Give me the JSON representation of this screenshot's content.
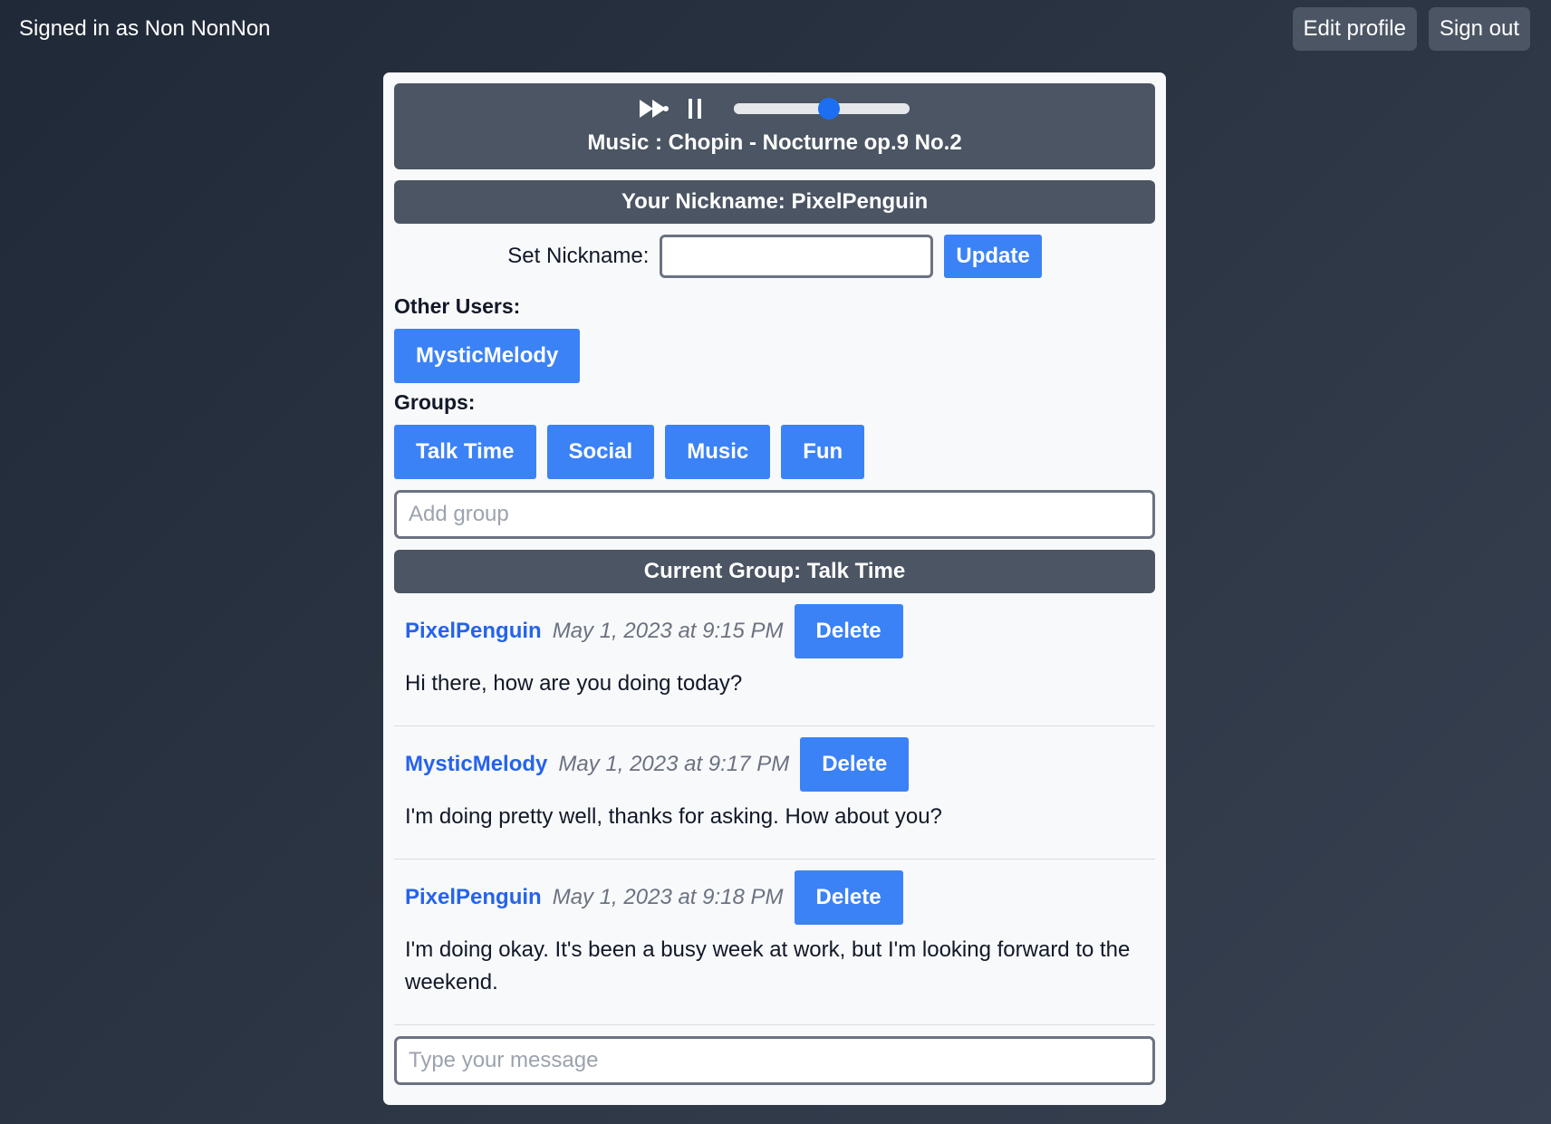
{
  "topbar": {
    "signed_in_text": "Signed in as Non NonNon",
    "edit_profile_label": "Edit profile",
    "sign_out_label": "Sign out"
  },
  "player": {
    "controls": [
      "fast-forward-icon",
      "pause-icon"
    ],
    "volume_level": 0.54,
    "track_text": "Music : Chopin - Nocturne op.9 No.2"
  },
  "nickname": {
    "banner": "Your Nickname: PixelPenguin",
    "set_label": "Set Nickname:",
    "input_value": "",
    "update_label": "Update"
  },
  "other_users": {
    "heading": "Other Users:",
    "users": [
      "MysticMelody"
    ]
  },
  "groups": {
    "heading": "Groups:",
    "items": [
      "Talk Time",
      "Social",
      "Music",
      "Fun"
    ],
    "add_placeholder": "Add group"
  },
  "current_group": {
    "banner": "Current Group: Talk Time"
  },
  "messages": [
    {
      "author": "PixelPenguin",
      "time": "May 1, 2023 at 9:15 PM",
      "delete_label": "Delete",
      "text": "Hi there, how are you doing today?"
    },
    {
      "author": "MysticMelody",
      "time": "May 1, 2023 at 9:17 PM",
      "delete_label": "Delete",
      "text": "I'm doing pretty well, thanks for asking. How about you?"
    },
    {
      "author": "PixelPenguin",
      "time": "May 1, 2023 at 9:18 PM",
      "delete_label": "Delete",
      "text": "I'm doing okay. It's been a busy week at work, but I'm looking forward to the weekend."
    }
  ],
  "composer": {
    "placeholder": "Type your message"
  },
  "colors": {
    "accent": "#3b82f6",
    "author": "#2563eb",
    "banner": "#4b5563",
    "slider_thumb": "#1d6ff2"
  }
}
